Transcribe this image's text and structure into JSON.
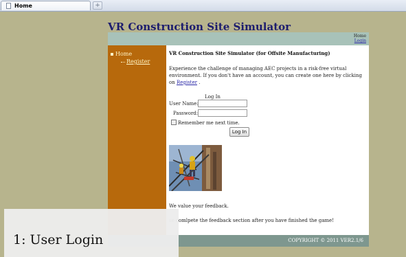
{
  "browser": {
    "tab_title": "Home",
    "new_tab_symbol": "+"
  },
  "site": {
    "title": "VR Construction Site Simulator",
    "topnav": {
      "home": "Home",
      "login": "Login"
    },
    "sidebar": {
      "home": "Home",
      "register": "Register"
    },
    "content": {
      "heading": "VR Construction Site Simulator (for Offsite Manufacturing)",
      "intro_text": "Experience the challenge of managing AEC projects in a risk-free virtual environment. If you don't have an account, you can create one here by clicking on ",
      "intro_link": "Register",
      "intro_end": " .",
      "login": {
        "legend": "Log In",
        "username_label": "User Name:",
        "username_value": "",
        "password_label": "Password:",
        "password_value": "",
        "remember_label": "Remember me next time.",
        "button_label": "Log In"
      },
      "feedback_1": "We value your feedback.",
      "feedback_2": "se comlpete the feedback section after you have finished the game!"
    },
    "footer": {
      "copyright": "COPYRIGHT © 2011 VER2.1/6"
    }
  },
  "overlay": {
    "caption": "1: User Login"
  },
  "colors": {
    "page_bg": "#b7b48d",
    "sidebar": "#b7690c",
    "topbar": "#a8c2b9",
    "footer": "#7e978f",
    "title": "#1d1d6e",
    "link": "#2d2ba8"
  }
}
